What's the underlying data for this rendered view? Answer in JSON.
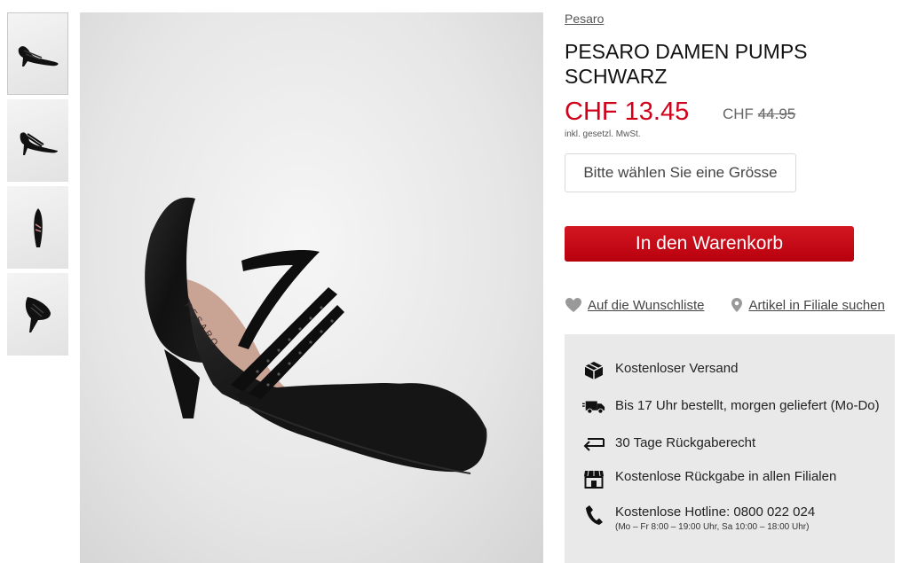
{
  "product": {
    "brand": "Pesaro",
    "title": "PESARO DAMEN PUMPS SCHWARZ",
    "price": "CHF 13.45",
    "old_price_currency": "CHF",
    "old_price_value": "44.95",
    "tax_note": "inkl. gesetzl. MwSt."
  },
  "gallery": {
    "main_image_stamp": "PESARO"
  },
  "size_select": {
    "placeholder": "Bitte wählen Sie eine Grösse"
  },
  "cart_button": {
    "label": "In den Warenkorb"
  },
  "links": {
    "wishlist": "Auf die Wunschliste",
    "store_search": "Artikel in Filiale suchen"
  },
  "benefits": [
    {
      "icon": "package-icon",
      "text": "Kostenloser Versand"
    },
    {
      "icon": "truck-icon",
      "text": "Bis 17 Uhr bestellt, morgen geliefert (Mo-Do)"
    },
    {
      "icon": "return-arrow-icon",
      "text": "30 Tage Rückgaberecht"
    },
    {
      "icon": "store-icon",
      "text": "Kostenlose Rückgabe in allen Filialen"
    },
    {
      "icon": "phone-icon",
      "text": "Kostenlose Hotline: 0800 022 024",
      "sub": "(Mo – Fr 8:00 – 19:00 Uhr, Sa 10:00 – 18:00 Uhr)"
    }
  ],
  "colors": {
    "accent_red": "#d0021b",
    "panel_grey": "#e9e9e9"
  }
}
